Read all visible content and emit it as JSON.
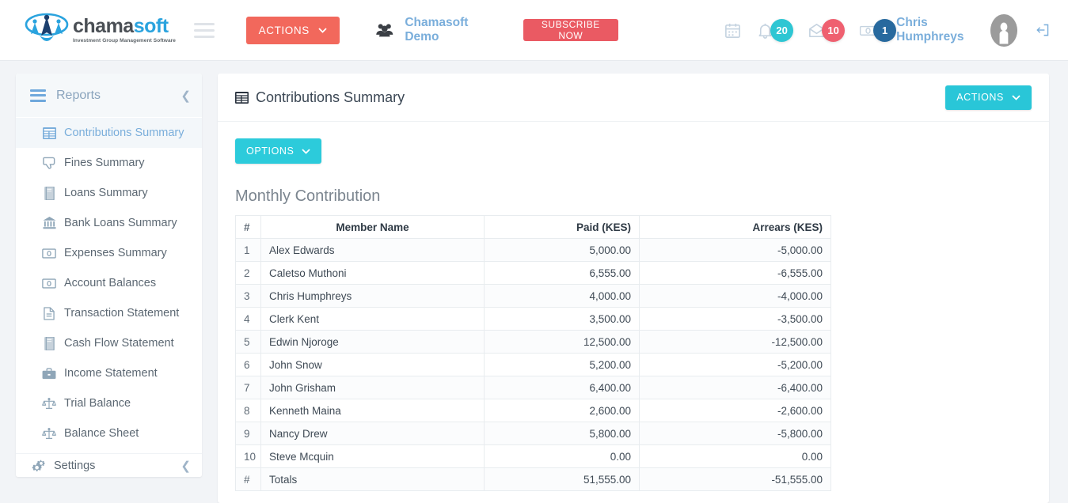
{
  "topbar": {
    "logo": {
      "word_dark": "chama",
      "word_blue": "soft",
      "tagline": "Investment Group Management Software"
    },
    "actions_label": "ACTIONS",
    "group_name": "Chamasoft Demo",
    "subscribe_label": "SUBSCRIBE NOW",
    "notifications": [
      {
        "icon": "calendar-icon",
        "badge": null,
        "badge_color": null
      },
      {
        "icon": "bell-icon",
        "badge": "20",
        "badge_color": "#2ec6d3"
      },
      {
        "icon": "envelope-open-icon",
        "badge": "10",
        "badge_color": "#ef6070"
      },
      {
        "icon": "money-icon",
        "badge": "1",
        "badge_color": "#27699e"
      }
    ],
    "user_name": "Chris Humphreys",
    "logout_icon": "logout-icon"
  },
  "sidebar": {
    "title": "Reports",
    "collapse_icon": "chevron-left-icon",
    "items": [
      {
        "label": "Contributions Summary",
        "icon": "table-report-icon",
        "active": true
      },
      {
        "label": "Fines Summary",
        "icon": "thumbs-down-icon",
        "active": false
      },
      {
        "label": "Loans Summary",
        "icon": "book-icon",
        "active": false
      },
      {
        "label": "Bank Loans Summary",
        "icon": "bank-icon",
        "active": false
      },
      {
        "label": "Expenses Summary",
        "icon": "money-icon",
        "active": false
      },
      {
        "label": "Account Balances",
        "icon": "money-icon",
        "active": false
      },
      {
        "label": "Transaction Statement",
        "icon": "document-icon",
        "active": false
      },
      {
        "label": "Cash Flow Statement",
        "icon": "book-icon",
        "active": false
      },
      {
        "label": "Income Statement",
        "icon": "briefcase-icon",
        "active": false
      },
      {
        "label": "Trial Balance",
        "icon": "scales-icon",
        "active": false
      },
      {
        "label": "Balance Sheet",
        "icon": "scales-icon",
        "active": false
      }
    ],
    "footer": {
      "label": "Settings",
      "icon": "gears-icon",
      "chevron": "chevron-left-icon"
    }
  },
  "panel": {
    "title": "Contributions Summary",
    "title_icon": "table-report-icon",
    "actions_label": "ACTIONS",
    "options_label": "OPTIONS",
    "section_title": "Monthly Contribution"
  },
  "table": {
    "headers": [
      "#",
      "Member Name",
      "Paid (KES)",
      "Arrears (KES)"
    ],
    "rows": [
      {
        "n": "1",
        "name": "Alex Edwards",
        "paid": "5,000.00",
        "arrears": "-5,000.00"
      },
      {
        "n": "2",
        "name": "Caletso Muthoni",
        "paid": "6,555.00",
        "arrears": "-6,555.00"
      },
      {
        "n": "3",
        "name": "Chris Humphreys",
        "paid": "4,000.00",
        "arrears": "-4,000.00"
      },
      {
        "n": "4",
        "name": "Clerk Kent",
        "paid": "3,500.00",
        "arrears": "-3,500.00"
      },
      {
        "n": "5",
        "name": "Edwin Njoroge",
        "paid": "12,500.00",
        "arrears": "-12,500.00"
      },
      {
        "n": "6",
        "name": "John Snow",
        "paid": "5,200.00",
        "arrears": "-5,200.00"
      },
      {
        "n": "7",
        "name": "John Grisham",
        "paid": "6,400.00",
        "arrears": "-6,400.00"
      },
      {
        "n": "8",
        "name": "Kenneth Maina",
        "paid": "2,600.00",
        "arrears": "-2,600.00"
      },
      {
        "n": "9",
        "name": "Nancy Drew",
        "paid": "5,800.00",
        "arrears": "-5,800.00"
      },
      {
        "n": "10",
        "name": "Steve Mcquin",
        "paid": "0.00",
        "arrears": "0.00"
      }
    ],
    "totals": {
      "n": "#",
      "name": "Totals",
      "paid": "51,555.00",
      "arrears": "-51,555.00"
    }
  },
  "colors": {
    "accent_red": "#f2685c",
    "accent_cyan": "#2ccbdb",
    "subscribe_red": "#ea5a63",
    "link_blue": "#7aaedb"
  }
}
